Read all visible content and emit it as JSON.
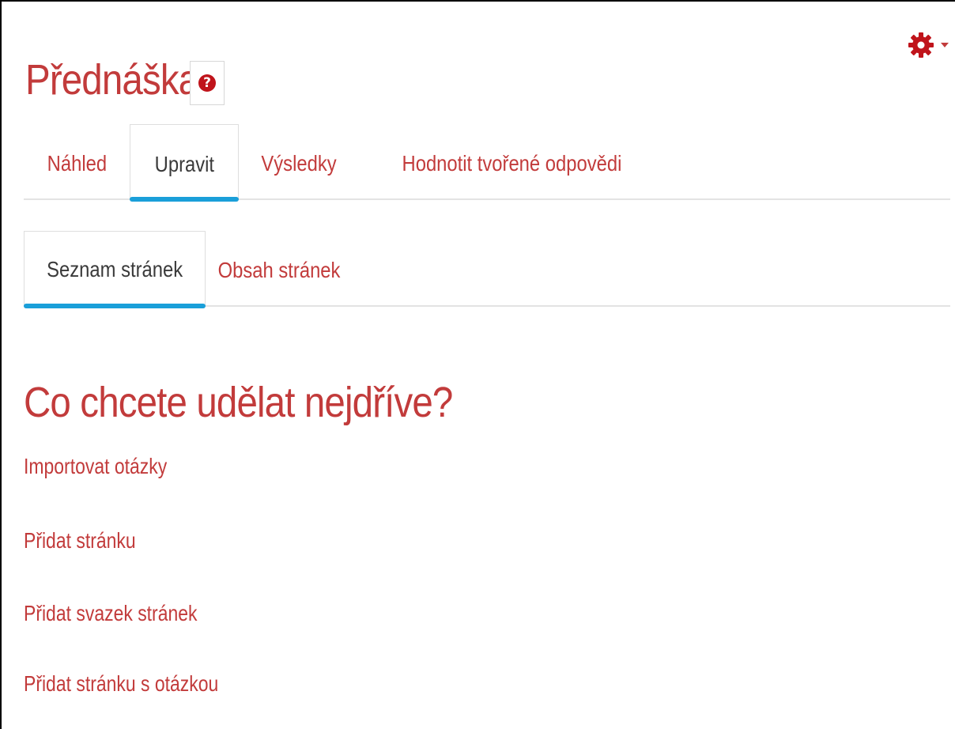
{
  "page": {
    "title": "Přednáška",
    "help_icon": "question-circle-icon",
    "settings_icon": "gear-icon"
  },
  "colors": {
    "link": "#c23b3b",
    "active_tab_text": "#3a3a3a",
    "active_indicator": "#1a9fd9",
    "help_icon": "#c0141b"
  },
  "main_tabs": [
    {
      "label": "Náhled",
      "active": false
    },
    {
      "label": "Upravit",
      "active": true
    },
    {
      "label": "Výsledky",
      "active": false
    },
    {
      "label": "Hodnotit tvořené odpovědi",
      "active": false
    }
  ],
  "sub_tabs": [
    {
      "label": "Seznam stránek",
      "active": true
    },
    {
      "label": "Obsah stránek",
      "active": false
    }
  ],
  "content": {
    "heading": "Co chcete udělat nejdříve?",
    "actions": [
      "Importovat otázky",
      "Přidat stránku",
      "Přidat svazek stránek",
      "Přidat stránku s otázkou"
    ]
  }
}
